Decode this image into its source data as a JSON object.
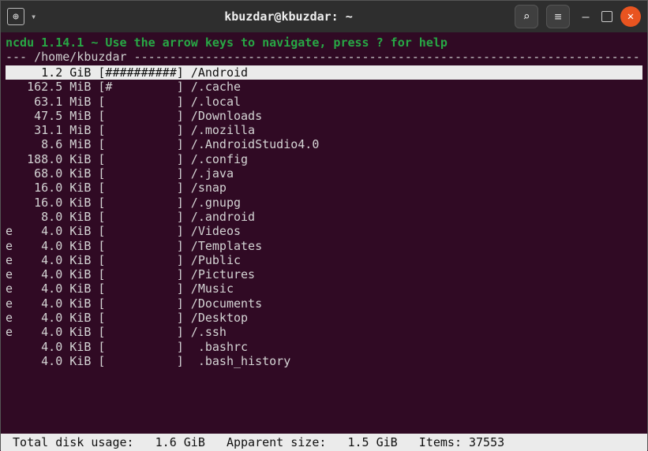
{
  "titlebar": {
    "title": "kbuzdar@kbuzdar: ~",
    "newtab_icon": "⊕",
    "dropdown_icon": "▾",
    "search_icon": "⌕",
    "menu_icon": "≡",
    "minimize_icon": "—",
    "close_icon": "✕"
  },
  "hint": "ncdu 1.14.1 ~ Use the arrow keys to navigate, press ? for help",
  "path_prefix": "--- ",
  "path": "/home/kbuzdar",
  "entries": [
    {
      "flag": " ",
      "size": "1.2",
      "unit": "GiB",
      "bar": "##########",
      "name": "/Android",
      "selected": true
    },
    {
      "flag": " ",
      "size": "162.5",
      "unit": "MiB",
      "bar": "#         ",
      "name": "/.cache"
    },
    {
      "flag": " ",
      "size": "63.1",
      "unit": "MiB",
      "bar": "          ",
      "name": "/.local"
    },
    {
      "flag": " ",
      "size": "47.5",
      "unit": "MiB",
      "bar": "          ",
      "name": "/Downloads"
    },
    {
      "flag": " ",
      "size": "31.1",
      "unit": "MiB",
      "bar": "          ",
      "name": "/.mozilla"
    },
    {
      "flag": " ",
      "size": "8.6",
      "unit": "MiB",
      "bar": "          ",
      "name": "/.AndroidStudio4.0"
    },
    {
      "flag": " ",
      "size": "188.0",
      "unit": "KiB",
      "bar": "          ",
      "name": "/.config"
    },
    {
      "flag": " ",
      "size": "68.0",
      "unit": "KiB",
      "bar": "          ",
      "name": "/.java"
    },
    {
      "flag": " ",
      "size": "16.0",
      "unit": "KiB",
      "bar": "          ",
      "name": "/snap"
    },
    {
      "flag": " ",
      "size": "16.0",
      "unit": "KiB",
      "bar": "          ",
      "name": "/.gnupg"
    },
    {
      "flag": " ",
      "size": "8.0",
      "unit": "KiB",
      "bar": "          ",
      "name": "/.android"
    },
    {
      "flag": "e",
      "size": "4.0",
      "unit": "KiB",
      "bar": "          ",
      "name": "/Videos"
    },
    {
      "flag": "e",
      "size": "4.0",
      "unit": "KiB",
      "bar": "          ",
      "name": "/Templates"
    },
    {
      "flag": "e",
      "size": "4.0",
      "unit": "KiB",
      "bar": "          ",
      "name": "/Public"
    },
    {
      "flag": "e",
      "size": "4.0",
      "unit": "KiB",
      "bar": "          ",
      "name": "/Pictures"
    },
    {
      "flag": "e",
      "size": "4.0",
      "unit": "KiB",
      "bar": "          ",
      "name": "/Music"
    },
    {
      "flag": "e",
      "size": "4.0",
      "unit": "KiB",
      "bar": "          ",
      "name": "/Documents"
    },
    {
      "flag": "e",
      "size": "4.0",
      "unit": "KiB",
      "bar": "          ",
      "name": "/Desktop"
    },
    {
      "flag": "e",
      "size": "4.0",
      "unit": "KiB",
      "bar": "          ",
      "name": "/.ssh"
    },
    {
      "flag": " ",
      "size": "4.0",
      "unit": "KiB",
      "bar": "          ",
      "name": " .bashrc"
    },
    {
      "flag": " ",
      "size": "4.0",
      "unit": "KiB",
      "bar": "          ",
      "name": " .bash_history"
    }
  ],
  "status": {
    "total_label": "Total disk usage:",
    "total_value": "1.6 GiB",
    "apparent_label": "Apparent size:",
    "apparent_value": "1.5 GiB",
    "items_label": "Items:",
    "items_value": "37553"
  }
}
